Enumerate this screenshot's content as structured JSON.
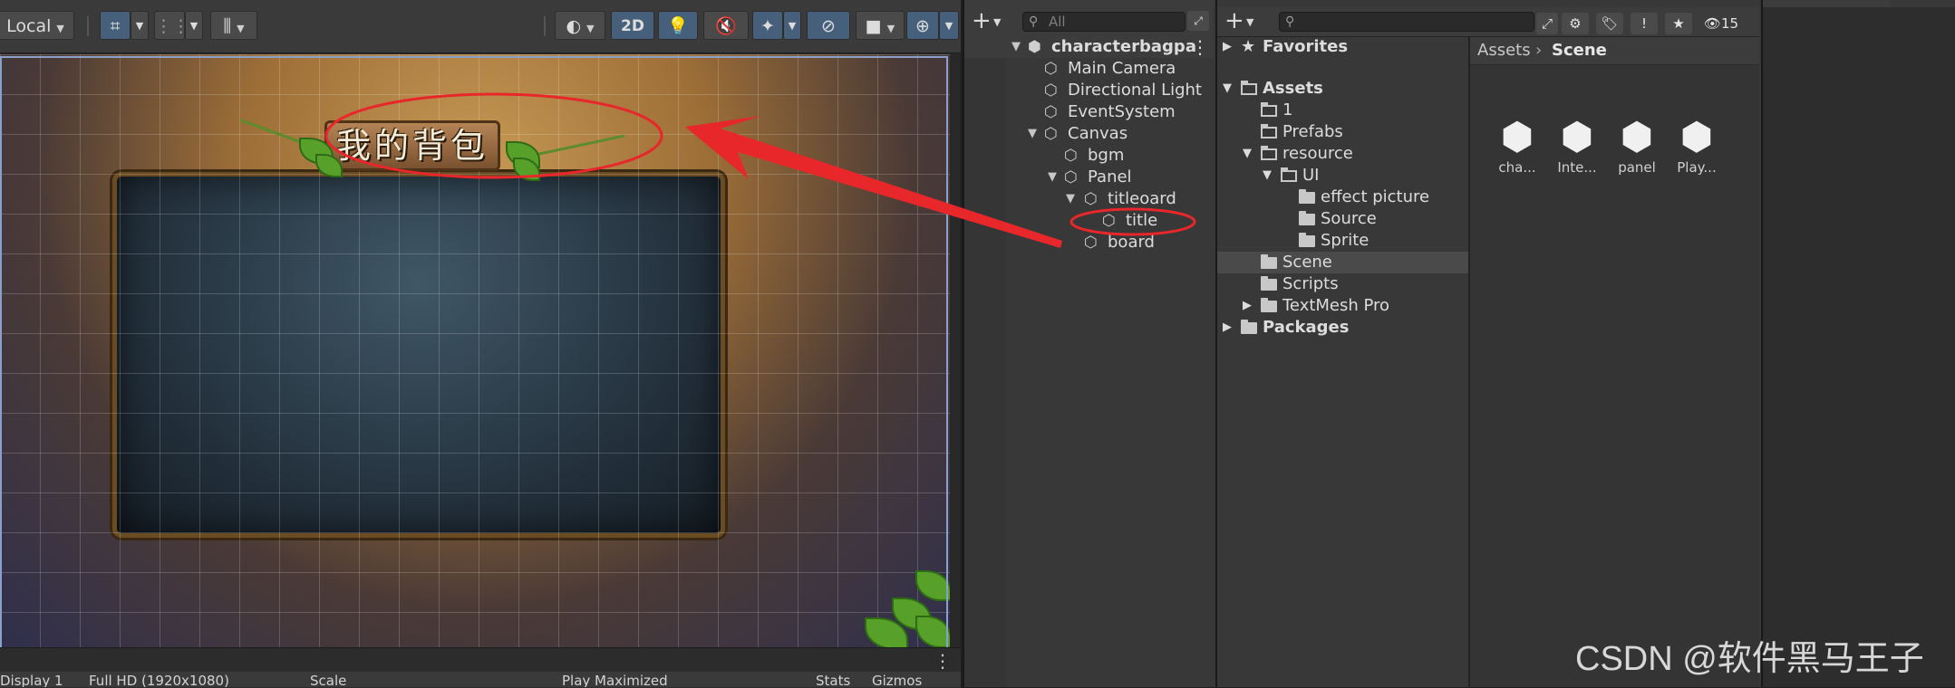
{
  "scene": {
    "toolbar": {
      "pivot_rotation": "Local",
      "mode_2d": "2D"
    },
    "canvas_title": "我的背包",
    "statusbar": {
      "display": "Display 1",
      "resolution": "Full HD (1920x1080)",
      "scale": "Scale",
      "play_mode": "Play Maximized",
      "stats": "Stats",
      "gizmos": "Gizmos"
    }
  },
  "hierarchy": {
    "search_placeholder": "All",
    "scene_name": "characterbagpa",
    "items": [
      {
        "label": "Main Camera"
      },
      {
        "label": "Directional Light"
      },
      {
        "label": "EventSystem"
      },
      {
        "label": "Canvas"
      },
      {
        "label": "bgm"
      },
      {
        "label": "Panel"
      },
      {
        "label": "titleoard"
      },
      {
        "label": "title"
      },
      {
        "label": "board"
      }
    ]
  },
  "project": {
    "hidden_count": "15",
    "favorites_label": "Favorites",
    "assets_label": "Assets",
    "folders": [
      {
        "label": "1"
      },
      {
        "label": "Prefabs"
      },
      {
        "label": "resource"
      },
      {
        "label": "UI"
      },
      {
        "label": "effect picture"
      },
      {
        "label": "Source"
      },
      {
        "label": "Sprite"
      },
      {
        "label": "Scene"
      },
      {
        "label": "Scripts"
      },
      {
        "label": "TextMesh Pro"
      }
    ],
    "packages_label": "Packages",
    "breadcrumb": {
      "root": "Assets",
      "current": "Scene"
    },
    "grid_items": [
      {
        "label": "cha..."
      },
      {
        "label": "Inte..."
      },
      {
        "label": "panel"
      },
      {
        "label": "Play..."
      }
    ]
  },
  "watermark": "CSDN @软件黑马王子",
  "colors": {
    "annotation_red": "#e8272b",
    "selected_row": "#4a4a4a",
    "toolbar_active": "#46607c"
  }
}
